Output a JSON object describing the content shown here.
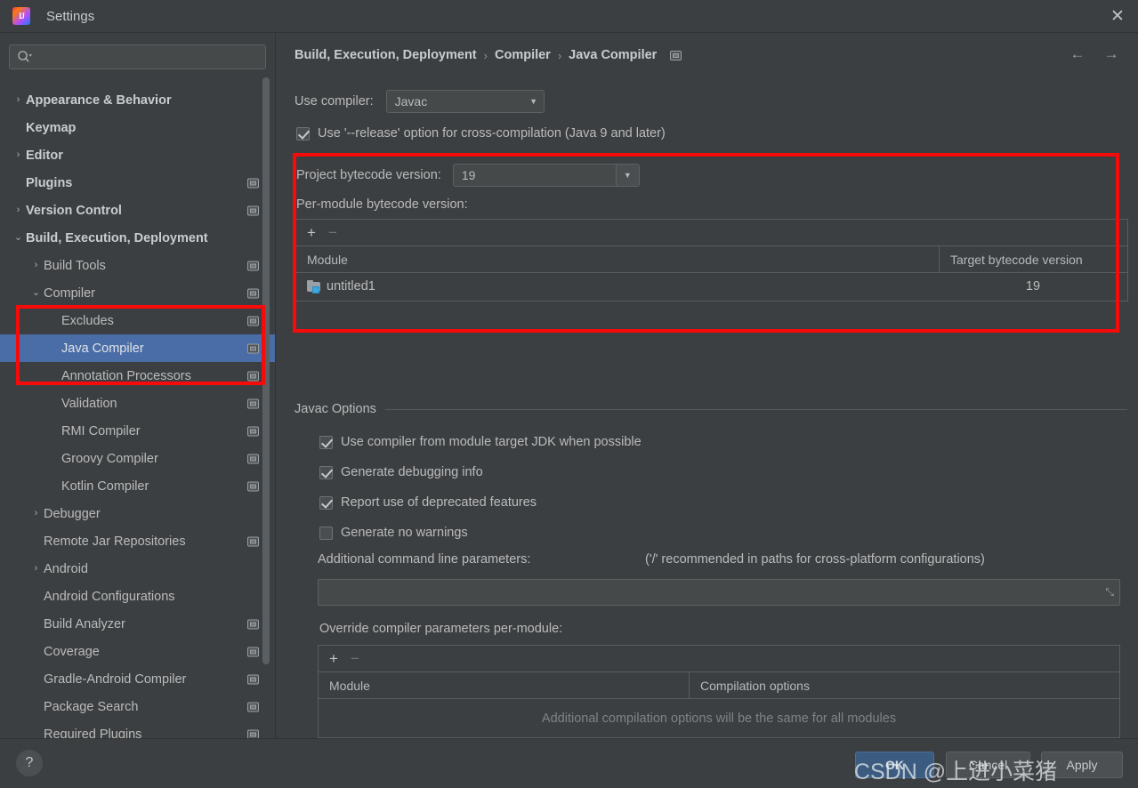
{
  "window": {
    "title": "Settings",
    "logo_icon": "intellij-idea-logo",
    "close_icon": "✕"
  },
  "search": {
    "value": "",
    "placeholder": "",
    "icon": "search-icon"
  },
  "sidebar": {
    "items": [
      {
        "label": "Appearance & Behavior",
        "arrow": "›",
        "indent": 0,
        "bold": true,
        "badge": false,
        "selected": false
      },
      {
        "label": "Keymap",
        "arrow": "",
        "indent": 0,
        "bold": true,
        "badge": false,
        "selected": false
      },
      {
        "label": "Editor",
        "arrow": "›",
        "indent": 0,
        "bold": true,
        "badge": false,
        "selected": false
      },
      {
        "label": "Plugins",
        "arrow": "",
        "indent": 0,
        "bold": true,
        "badge": true,
        "selected": false
      },
      {
        "label": "Version Control",
        "arrow": "›",
        "indent": 0,
        "bold": true,
        "badge": true,
        "selected": false
      },
      {
        "label": "Build, Execution, Deployment",
        "arrow": "⌄",
        "indent": 0,
        "bold": true,
        "badge": false,
        "selected": false
      },
      {
        "label": "Build Tools",
        "arrow": "›",
        "indent": 1,
        "bold": false,
        "badge": true,
        "selected": false
      },
      {
        "label": "Compiler",
        "arrow": "⌄",
        "indent": 1,
        "bold": false,
        "badge": true,
        "selected": false
      },
      {
        "label": "Excludes",
        "arrow": "",
        "indent": 2,
        "bold": false,
        "badge": true,
        "selected": false
      },
      {
        "label": "Java Compiler",
        "arrow": "",
        "indent": 2,
        "bold": false,
        "badge": true,
        "selected": true
      },
      {
        "label": "Annotation Processors",
        "arrow": "",
        "indent": 2,
        "bold": false,
        "badge": true,
        "selected": false
      },
      {
        "label": "Validation",
        "arrow": "",
        "indent": 2,
        "bold": false,
        "badge": true,
        "selected": false
      },
      {
        "label": "RMI Compiler",
        "arrow": "",
        "indent": 2,
        "bold": false,
        "badge": true,
        "selected": false
      },
      {
        "label": "Groovy Compiler",
        "arrow": "",
        "indent": 2,
        "bold": false,
        "badge": true,
        "selected": false
      },
      {
        "label": "Kotlin Compiler",
        "arrow": "",
        "indent": 2,
        "bold": false,
        "badge": true,
        "selected": false
      },
      {
        "label": "Debugger",
        "arrow": "›",
        "indent": 1,
        "bold": false,
        "badge": false,
        "selected": false
      },
      {
        "label": "Remote Jar Repositories",
        "arrow": "",
        "indent": 1,
        "bold": false,
        "badge": true,
        "selected": false
      },
      {
        "label": "Android",
        "arrow": "›",
        "indent": 1,
        "bold": false,
        "badge": false,
        "selected": false
      },
      {
        "label": "Android Configurations",
        "arrow": "",
        "indent": 1,
        "bold": false,
        "badge": false,
        "selected": false
      },
      {
        "label": "Build Analyzer",
        "arrow": "",
        "indent": 1,
        "bold": false,
        "badge": true,
        "selected": false
      },
      {
        "label": "Coverage",
        "arrow": "",
        "indent": 1,
        "bold": false,
        "badge": true,
        "selected": false
      },
      {
        "label": "Gradle-Android Compiler",
        "arrow": "",
        "indent": 1,
        "bold": false,
        "badge": true,
        "selected": false
      },
      {
        "label": "Package Search",
        "arrow": "",
        "indent": 1,
        "bold": false,
        "badge": true,
        "selected": false
      },
      {
        "label": "Required Plugins",
        "arrow": "",
        "indent": 1,
        "bold": false,
        "badge": true,
        "selected": false
      }
    ]
  },
  "header": {
    "breadcrumb": [
      "Build, Execution, Deployment",
      "Compiler",
      "Java Compiler"
    ],
    "separator": "›",
    "badge_icon": "project-settings-badge-icon",
    "back_icon": "←",
    "forward_icon": "→"
  },
  "main": {
    "use_compiler_label": "Use compiler:",
    "use_compiler_value": "Javac",
    "release_option": {
      "label": "Use '--release' option for cross-compilation (Java 9 and later)",
      "checked": true
    },
    "project_bytecode_label": "Project bytecode version:",
    "project_bytecode_value": "19",
    "per_module_label": "Per-module bytecode version:",
    "per_module_table": {
      "add_icon": "+",
      "remove_icon": "−",
      "columns": [
        "Module",
        "Target bytecode version"
      ],
      "rows": [
        {
          "module": "untitled1",
          "version": "19",
          "icon": "module-folder-icon"
        }
      ]
    },
    "javac_options_title": "Javac Options",
    "javac_options": [
      {
        "label": "Use compiler from module target JDK when possible",
        "checked": true
      },
      {
        "label": "Generate debugging info",
        "checked": true
      },
      {
        "label": "Report use of deprecated features",
        "checked": true
      },
      {
        "label": "Generate no warnings",
        "checked": false
      }
    ],
    "additional_params_label": "Additional command line parameters:",
    "additional_params_hint": "('/' recommended in paths for cross-platform configurations)",
    "additional_params_value": "",
    "expand_icon": "⤡",
    "override_label": "Override compiler parameters per-module:",
    "override_table": {
      "add_icon": "+",
      "remove_icon": "−",
      "columns": [
        "Module",
        "Compilation options"
      ],
      "empty_text": "Additional compilation options will be the same for all modules"
    }
  },
  "footer": {
    "help_icon": "?",
    "ok_label": "OK",
    "cancel_label": "Cancel",
    "apply_label": "Apply"
  },
  "watermark": {
    "text": "CSDN @上进小菜猪"
  },
  "colors": {
    "window_bg": "#3c3f41",
    "selection_blue": "#4a6da7",
    "primary_button": "#3b5c80",
    "annotation_red": "#f70a0a",
    "module_badge_blue": "#3ba8e0"
  }
}
